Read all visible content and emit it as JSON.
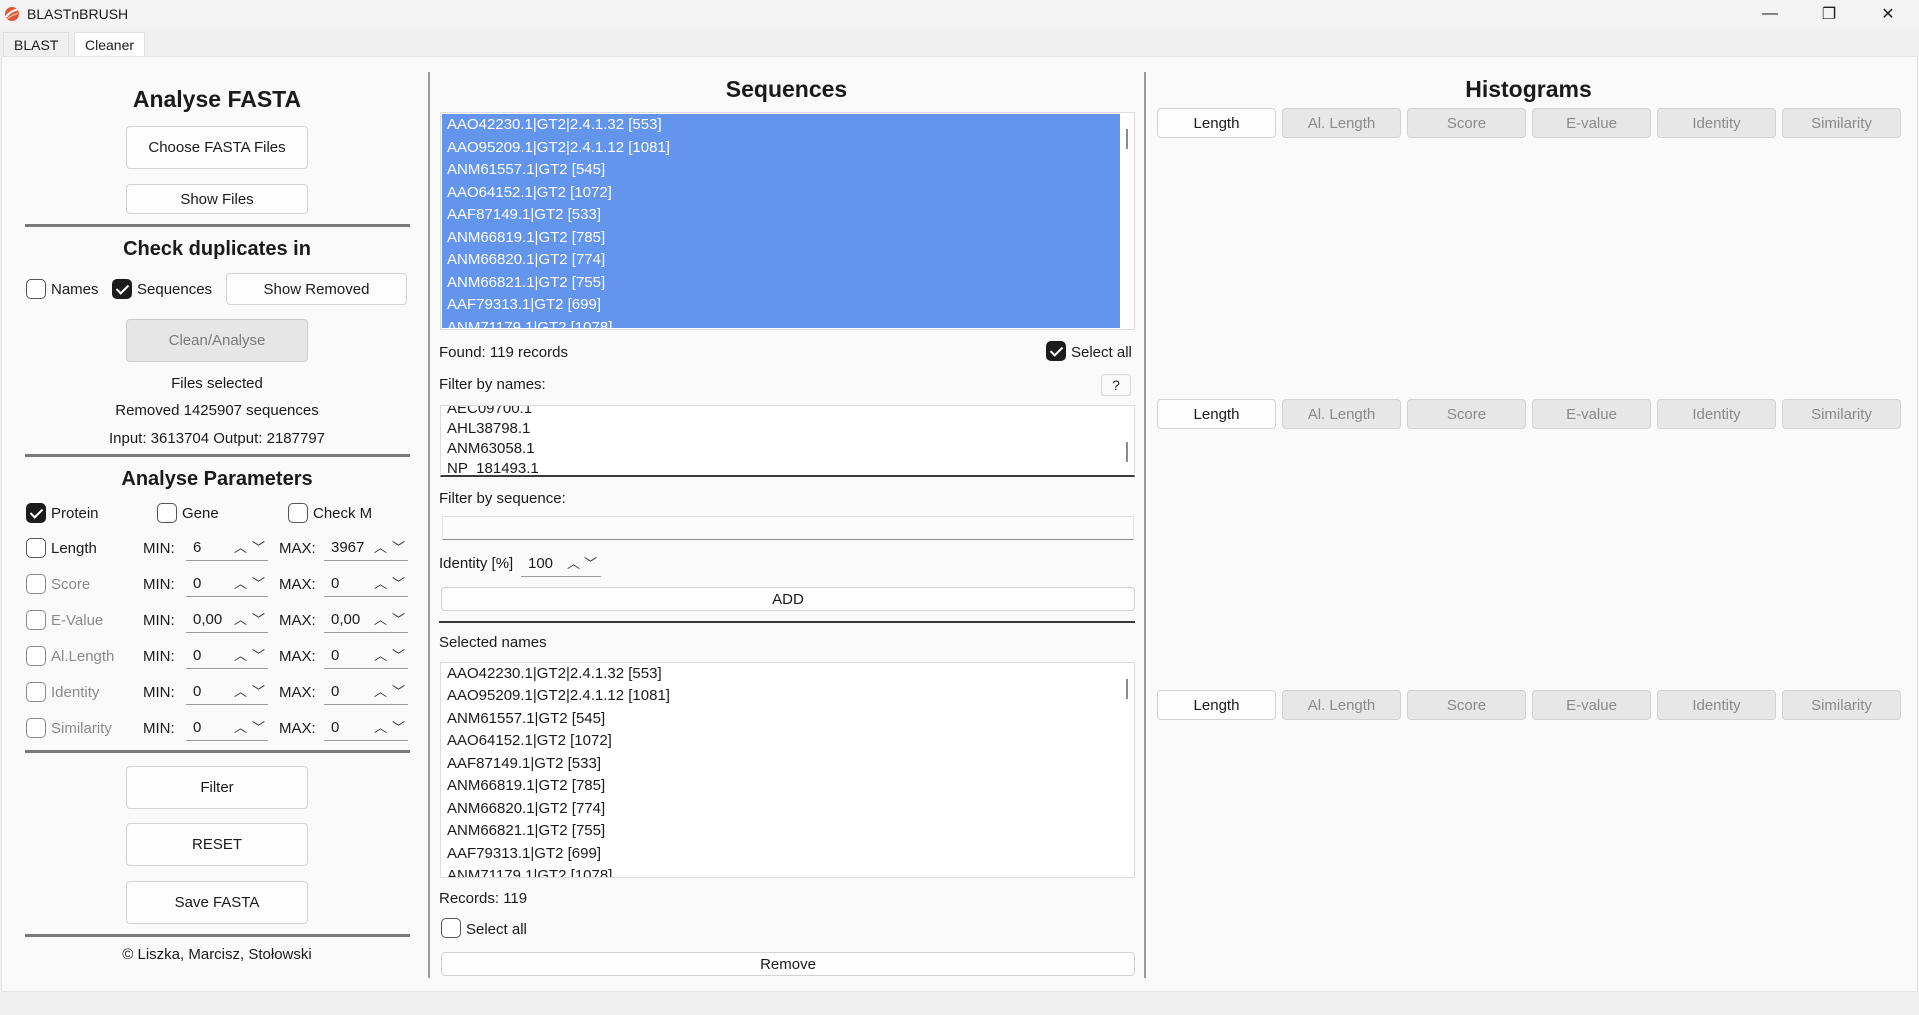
{
  "window": {
    "title": "BLASTnBRUSH",
    "minimize": "—",
    "restore": "❐",
    "close": "✕"
  },
  "app_tabs": [
    {
      "label": "BLAST"
    },
    {
      "label": "Cleaner"
    }
  ],
  "left": {
    "title": "Analyse FASTA",
    "choose_files": "Choose FASTA Files",
    "show_files": "Show Files",
    "dup_title": "Check duplicates in",
    "names_label": "Names",
    "sequences_label": "Sequences",
    "show_removed": "Show Removed",
    "clean_analyse": "Clean/Analyse",
    "files_selected": "Files selected",
    "removed_text": "Removed 1425907 sequences",
    "io_text": "Input: 3613704 Output: 2187797",
    "params_title": "Analyse Parameters",
    "protein_label": "Protein",
    "gene_label": "Gene",
    "checkm_label": "Check M",
    "min_label": "MIN:",
    "max_label": "MAX:",
    "params": [
      {
        "label": "Length",
        "min": "6",
        "max": "3967"
      },
      {
        "label": "Score",
        "min": "0",
        "max": "0"
      },
      {
        "label": "E-Value",
        "min": "0,00",
        "max": "0,00"
      },
      {
        "label": "Al.Length",
        "min": "0",
        "max": "0"
      },
      {
        "label": "Identity",
        "min": "0",
        "max": "0"
      },
      {
        "label": "Similarity",
        "min": "0",
        "max": "0"
      }
    ],
    "filter": "Filter",
    "reset": "RESET",
    "save": "Save FASTA",
    "copyright": "© Liszka, Marcisz, Stołowski"
  },
  "middle": {
    "title": "Sequences",
    "sequences": [
      "AAO42230.1|GT2|2.4.1.32 [553]",
      "AAO95209.1|GT2|2.4.1.12 [1081]",
      "ANM61557.1|GT2 [545]",
      "AAO64152.1|GT2 [1072]",
      "AAF87149.1|GT2 [533]",
      "ANM66819.1|GT2 [785]",
      "ANM66820.1|GT2 [774]",
      "ANM66821.1|GT2 [755]",
      "AAF79313.1|GT2 [699]",
      "ANM71179.1|GT2 [1078]"
    ],
    "found": "Found: 119 records",
    "select_all": "Select all",
    "filter_names_label": "Filter by names:",
    "help": "?",
    "filter_names": [
      "AEC09700.1",
      "AHL38798.1",
      "ANM63058.1",
      "NP_181493.1"
    ],
    "filter_seq_label": "Filter by sequence:",
    "filter_seq_value": "",
    "identity_label": "Identity [%]",
    "identity_value": "100",
    "add": "ADD",
    "selected_names_label": "Selected names",
    "selected": [
      "AAO42230.1|GT2|2.4.1.32 [553]",
      "AAO95209.1|GT2|2.4.1.12 [1081]",
      "ANM61557.1|GT2 [545]",
      "AAO64152.1|GT2 [1072]",
      "AAF87149.1|GT2 [533]",
      "ANM66819.1|GT2 [785]",
      "ANM66820.1|GT2 [774]",
      "ANM66821.1|GT2 [755]",
      "AAF79313.1|GT2 [699]",
      "ANM71179.1|GT2 [1078]"
    ],
    "records": "Records: 119",
    "select_all_bottom": "Select all",
    "remove": "Remove"
  },
  "right": {
    "title": "Histograms",
    "tabs": [
      "Length",
      "Al. Length",
      "Score",
      "E-value",
      "Identity",
      "Similarity"
    ]
  },
  "colors": {
    "selection": "#6495ed",
    "separator": "#7a7a7a"
  }
}
